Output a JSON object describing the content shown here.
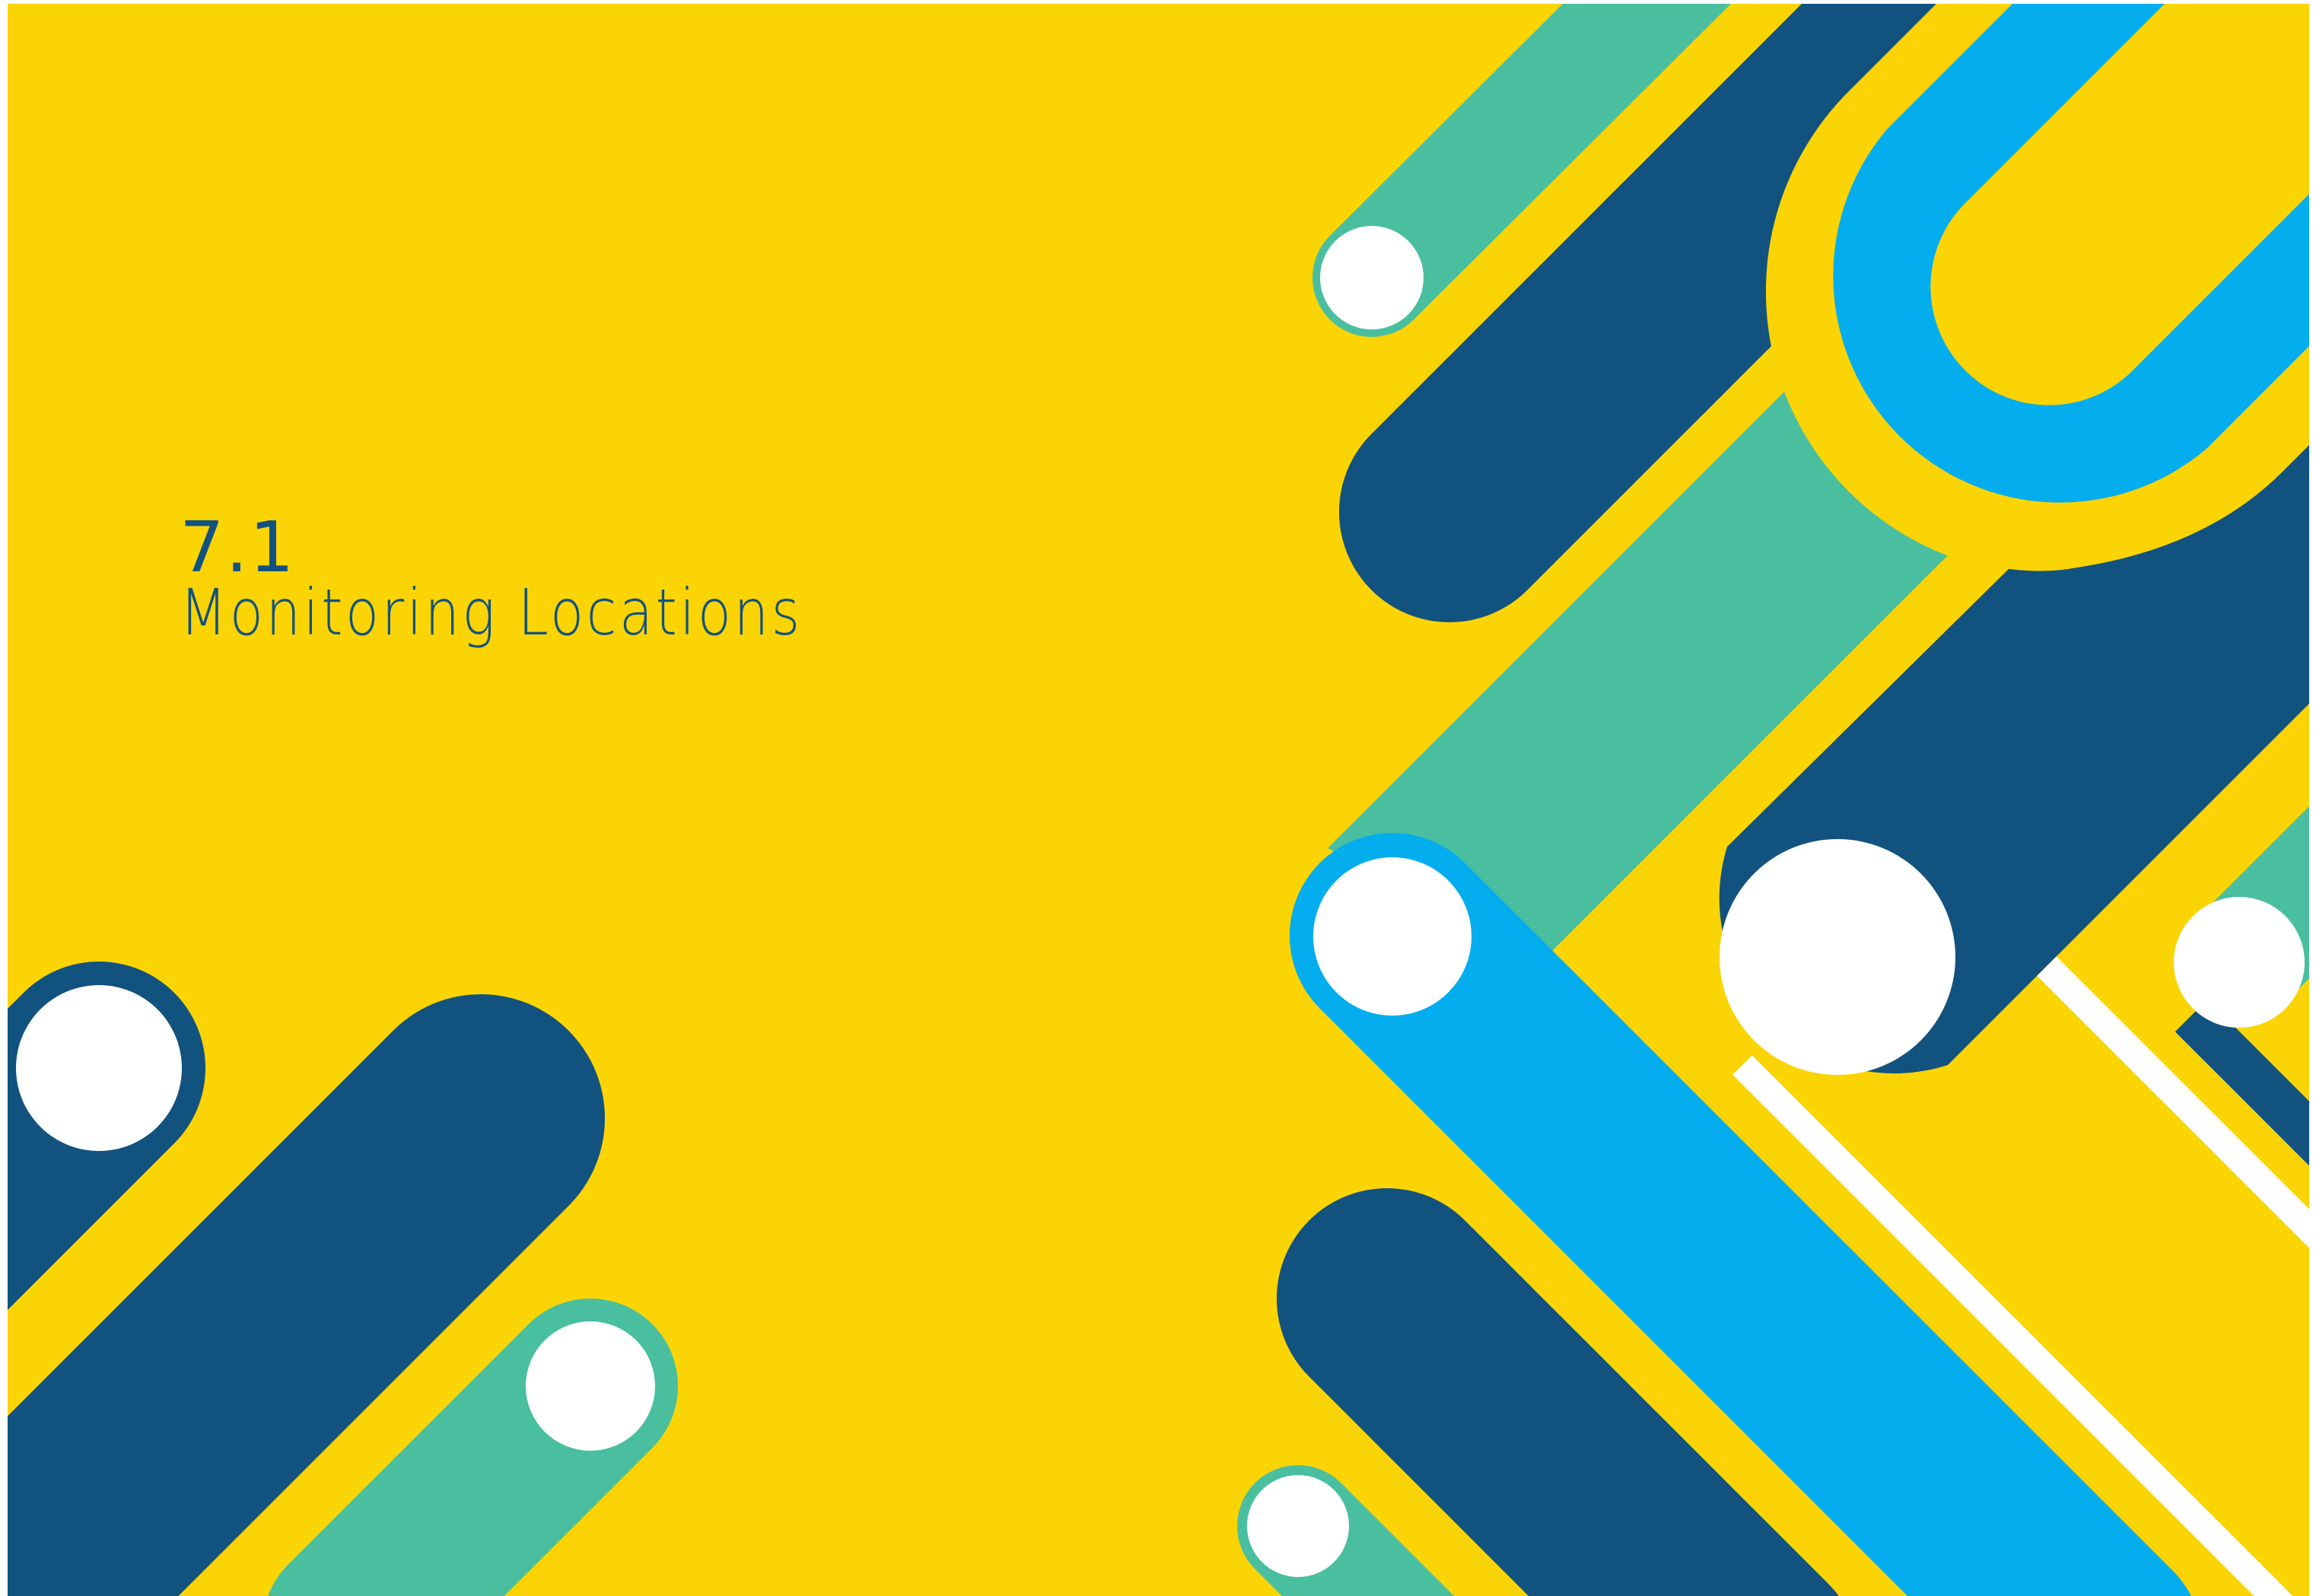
{
  "heading": {
    "section_number": "7.1",
    "section_title": "Monitoring Locations"
  },
  "colors": {
    "background": "#FBD406",
    "border": "#FFFFFF",
    "dark_blue": "#12527F",
    "teal": "#4ABFA0",
    "sky_blue": "#03ADEE",
    "white": "#FFFFFF",
    "text": "#12527F"
  }
}
